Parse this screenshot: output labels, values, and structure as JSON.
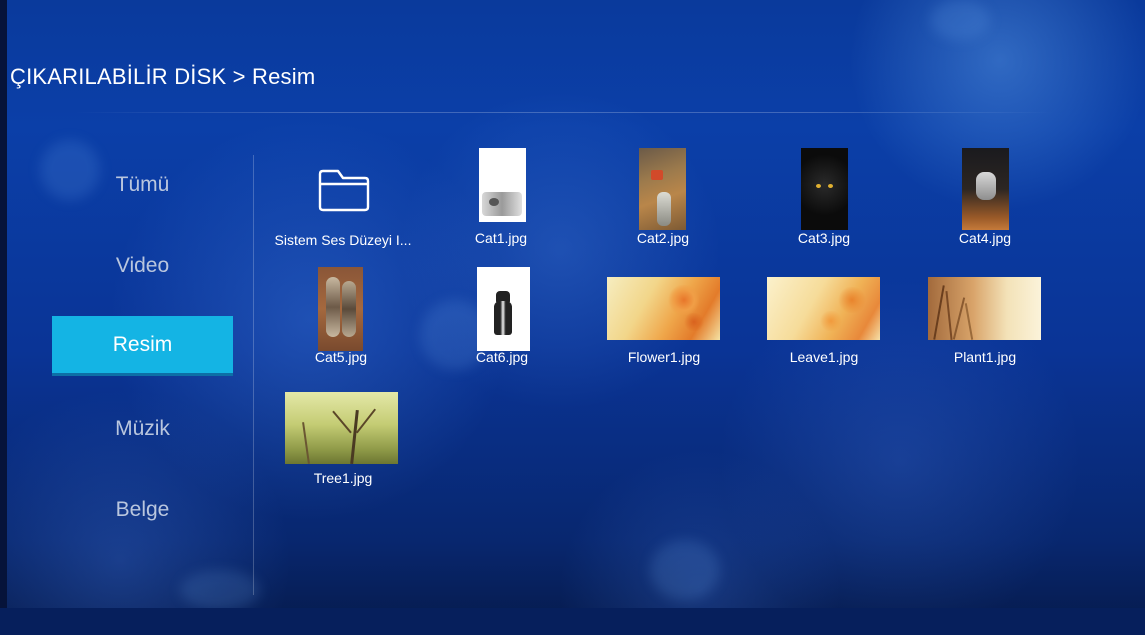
{
  "breadcrumb": "ÇIKARILABİLİR DİSK > Resim",
  "sidebar": {
    "items": [
      {
        "label": "Tümü",
        "active": false
      },
      {
        "label": "Video",
        "active": false
      },
      {
        "label": "Resim",
        "active": true
      },
      {
        "label": "Müzik",
        "active": false
      },
      {
        "label": "Belge",
        "active": false
      }
    ]
  },
  "colors": {
    "active_item": "#14b4e4",
    "background": "#0b3fa8",
    "inactive_text": "#b9c6de"
  },
  "files": [
    {
      "name": "Sistem Ses Düzeyi I...",
      "type": "folder",
      "icon": "folder-icon"
    },
    {
      "name": "Cat1.jpg",
      "type": "image"
    },
    {
      "name": "Cat2.jpg",
      "type": "image"
    },
    {
      "name": "Cat3.jpg",
      "type": "image"
    },
    {
      "name": "Cat4.jpg",
      "type": "image"
    },
    {
      "name": "Cat5.jpg",
      "type": "image"
    },
    {
      "name": "Cat6.jpg",
      "type": "image"
    },
    {
      "name": "Flower1.jpg",
      "type": "image"
    },
    {
      "name": "Leave1.jpg",
      "type": "image"
    },
    {
      "name": "Plant1.jpg",
      "type": "image"
    },
    {
      "name": "Tree1.jpg",
      "type": "image"
    }
  ]
}
